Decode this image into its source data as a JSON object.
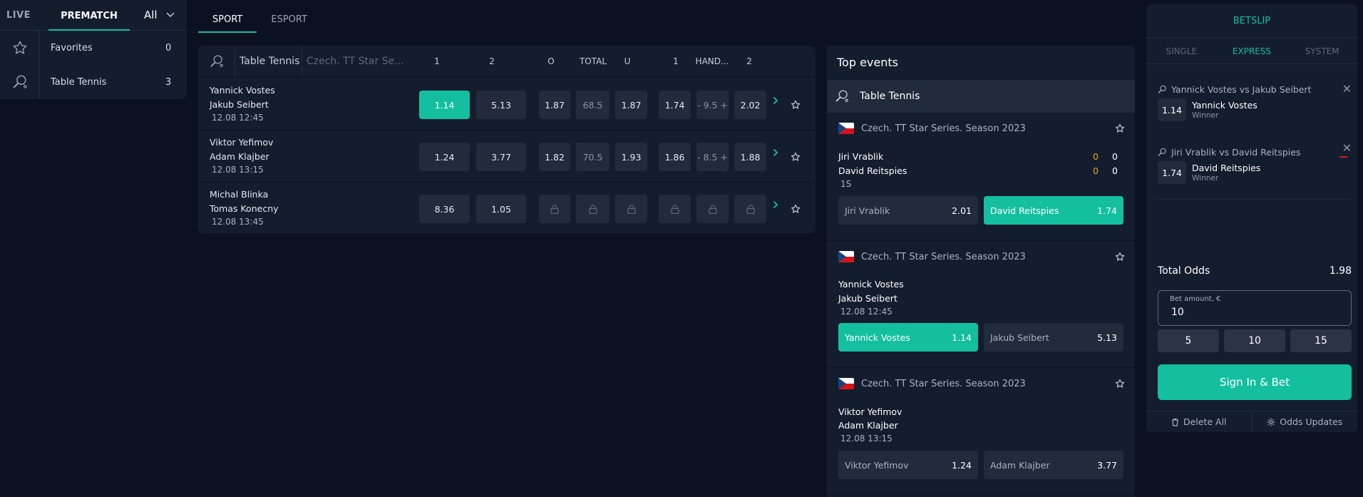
{
  "nav": {
    "live": "LIVE",
    "prematch": "PREMATCH",
    "all": "All"
  },
  "left": {
    "favorites": {
      "label": "Favorites",
      "count": "0"
    },
    "sport": {
      "label": "Table Tennis",
      "count": "3"
    }
  },
  "sport_tabs": [
    "SPORT",
    "ESPORT"
  ],
  "table": {
    "sport": "Table Tennis",
    "tournament": "Czech. TT Star Se...",
    "headers": [
      "1",
      "2",
      "O",
      "TOTAL",
      "U",
      "1",
      "HAND...",
      "2"
    ],
    "rows": [
      {
        "p1": "Yannick Vostes",
        "p2": "Jakub Seibert",
        "date": "12.08 12:45",
        "w1": "1.14",
        "w2": "5.13",
        "over": "1.87",
        "total": "68.5",
        "under": "1.87",
        "h1": "1.74",
        "hcp": "- 9.5 +",
        "h2": "2.02"
      },
      {
        "p1": "Viktor Yefimov",
        "p2": "Adam Klajber",
        "date": "12.08 13:15",
        "w1": "1.24",
        "w2": "3.77",
        "over": "1.82",
        "total": "70.5",
        "under": "1.93",
        "h1": "1.86",
        "hcp": "- 8.5 +",
        "h2": "1.88"
      },
      {
        "p1": "Michal Blinka",
        "p2": "Tomas Konecny",
        "date": "12.08 13:45",
        "w1": "8.36",
        "w2": "1.05",
        "over": "",
        "total": "",
        "under": "",
        "h1": "",
        "hcp": "",
        "h2": ""
      }
    ]
  },
  "top_events": {
    "title": "Top events",
    "sport": "Table Tennis",
    "cards": [
      {
        "tournament": "Czech. TT Star Series. Season 2023",
        "p1": "Jiri Vrablik",
        "p2": "David Reitspies",
        "s1a": "0",
        "s1b": "0",
        "s2a": "0",
        "s2b": "0",
        "period": "1S",
        "b1": "Jiri Vrablik",
        "o1": "2.01",
        "b2": "David Reitspies",
        "o2": "1.74"
      },
      {
        "tournament": "Czech. TT Star Series. Season 2023",
        "p1": "Yannick Vostes",
        "p2": "Jakub Seibert",
        "date": "12.08 12:45",
        "b1": "Yannick Vostes",
        "o1": "1.14",
        "b2": "Jakub Seibert",
        "o2": "5.13"
      },
      {
        "tournament": "Czech. TT Star Series. Season 2023",
        "p1": "Viktor Yefimov",
        "p2": "Adam Klajber",
        "date": "12.08 13:15",
        "b1": "Viktor Yefimov",
        "o1": "1.24",
        "b2": "Adam Klajber",
        "o2": "3.77"
      }
    ]
  },
  "betslip": {
    "title": "BETSLIP",
    "tabs": [
      "SINGLE",
      "EXPRESS",
      "SYSTEM"
    ],
    "selections": [
      {
        "match": "Yannick Vostes vs Jakub Seibert",
        "odd": "1.14",
        "name": "Yannick Vostes",
        "market": "Winner"
      },
      {
        "match": "Jiri Vrablik vs David Reitspies",
        "odd": "1.74",
        "name": "David Reitspies",
        "market": "Winner"
      }
    ],
    "total_label": "Total Odds",
    "total_value": "1.98",
    "amount_label": "Bet amount, €",
    "amount_value": "10",
    "quick": [
      "5",
      "10",
      "15"
    ],
    "bet_button": "Sign In & Bet",
    "delete_all": "Delete All",
    "odds_updates": "Odds Updates"
  },
  "colors": {
    "accent": "#14bfa0",
    "background": "#0b1120",
    "panel": "#141d2e",
    "button": "#222b3b"
  }
}
